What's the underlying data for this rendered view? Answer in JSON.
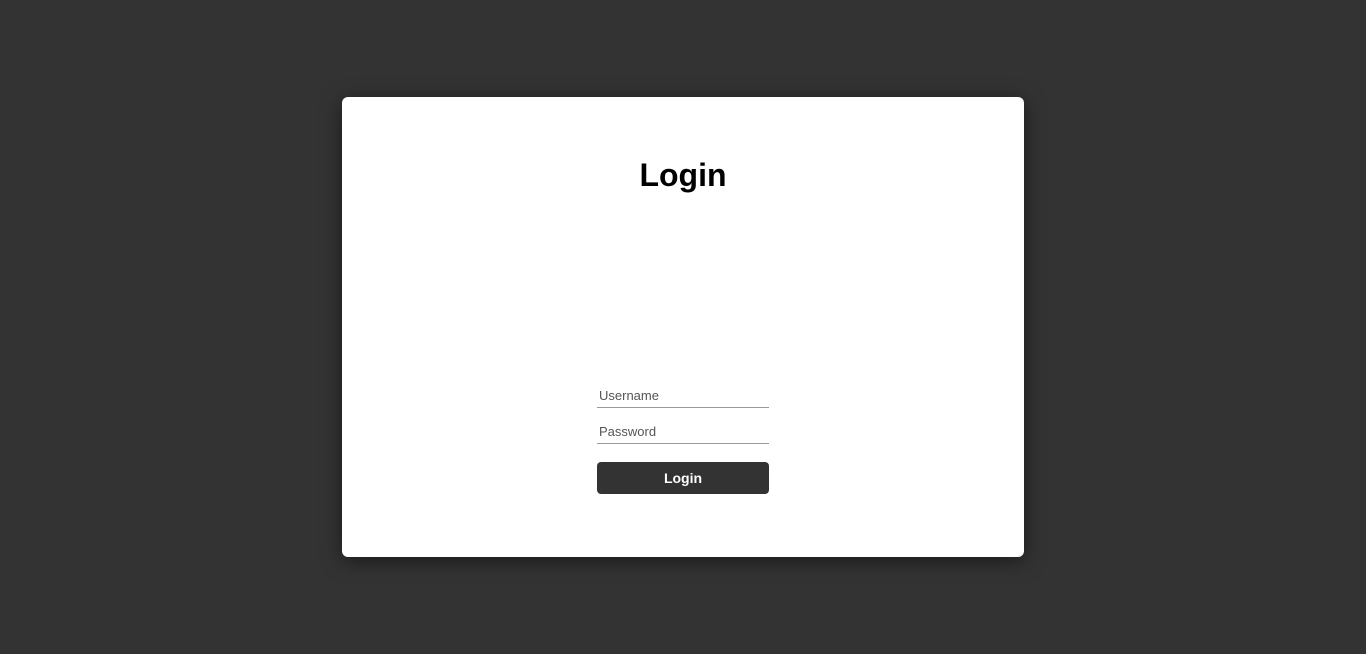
{
  "login": {
    "title": "Login",
    "username_placeholder": "Username",
    "password_placeholder": "Password",
    "button_label": "Login"
  }
}
